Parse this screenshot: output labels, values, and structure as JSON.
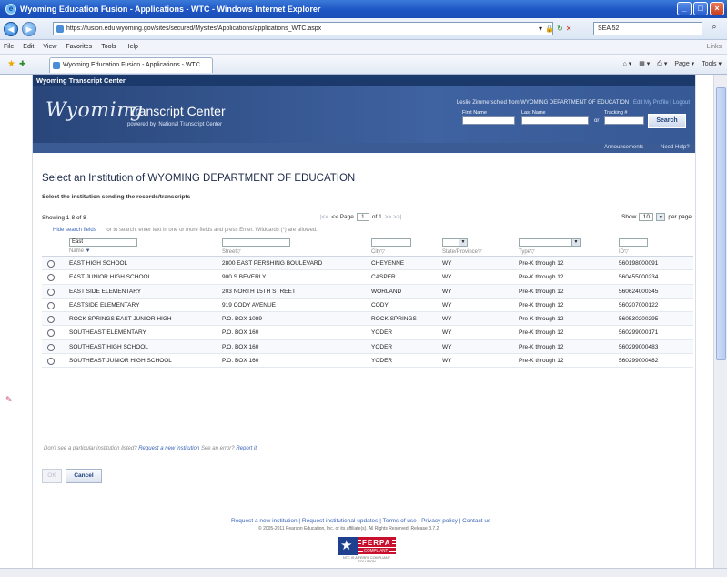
{
  "window": {
    "title": "Wyoming Education Fusion - Applications - WTC - Windows Internet Explorer",
    "url": "https://fusion.edu.wyoming.gov/sites/secured/Mysites/Applications/applications_WTC.aspx",
    "search_value": "SEA 52",
    "menu": [
      "File",
      "Edit",
      "View",
      "Favorites",
      "Tools",
      "Help"
    ],
    "links_label": "Links",
    "tab_label": "Wyoming Education Fusion - Applications - WTC",
    "tools": [
      "Page",
      "Tools"
    ]
  },
  "site": {
    "bar_title": "Wyoming Transcript Center",
    "logo_text": "Wyoming",
    "product": "Transcript Center",
    "powered_by": "powered by  National Transcript Center",
    "user_text": "Leslie Zimmerschied from WYOMING DEPARTMENT OF EDUCATION",
    "edit_profile": "Edit My Profile",
    "logout": "Logout",
    "first_name_label": "First Name",
    "last_name_label": "Last Name",
    "tracking_label": "Tracking #",
    "or_label": "or",
    "search_button": "Search",
    "announcements": "Announcements",
    "need_help": "Need Help?"
  },
  "main": {
    "heading": "Select an Institution of WYOMING DEPARTMENT OF EDUCATION",
    "subheading": "Select the institution sending the records/transcripts",
    "showing": "Showing 1-8 of 8",
    "pager_first": "|<<",
    "pager_prev": "<< Page",
    "page_value": "1",
    "pager_of": "of 1",
    "pager_next": ">> >>|",
    "show_label": "Show",
    "per_page_value": "10",
    "per_page_label": "per page",
    "hide_fields": "Hide search fields",
    "search_hint": "or to search, enter text in one or more fields and press Enter. Wildcards (*) are allowed.",
    "name_filter": "East",
    "columns": [
      "Name",
      "Street",
      "City",
      "State/Province",
      "Type",
      "ID"
    ],
    "rows": [
      {
        "name": "EAST HIGH SCHOOL",
        "street": "2800 EAST PERSHING BOULEVARD",
        "city": "CHEYENNE",
        "state": "WY",
        "type": "Pre-K through 12",
        "id": "560198000091"
      },
      {
        "name": "EAST JUNIOR HIGH SCHOOL",
        "street": "900 S BEVERLY",
        "city": "CASPER",
        "state": "WY",
        "type": "Pre-K through 12",
        "id": "560455000234"
      },
      {
        "name": "EAST SIDE ELEMENTARY",
        "street": "203 NORTH 15TH STREET",
        "city": "WORLAND",
        "state": "WY",
        "type": "Pre-K through 12",
        "id": "560624000345"
      },
      {
        "name": "EASTSIDE ELEMENTARY",
        "street": "919 CODY AVENUE",
        "city": "CODY",
        "state": "WY",
        "type": "Pre-K through 12",
        "id": "560207000122"
      },
      {
        "name": "ROCK SPRINGS EAST JUNIOR HIGH",
        "street": "P.O. BOX 1089",
        "city": "ROCK SPRINGS",
        "state": "WY",
        "type": "Pre-K through 12",
        "id": "560530200295"
      },
      {
        "name": "SOUTHEAST ELEMENTARY",
        "street": "P.O. BOX 160",
        "city": "YODER",
        "state": "WY",
        "type": "Pre-K through 12",
        "id": "560299000171"
      },
      {
        "name": "SOUTHEAST HIGH SCHOOL",
        "street": "P.O. BOX 160",
        "city": "YODER",
        "state": "WY",
        "type": "Pre-K through 12",
        "id": "560299000483"
      },
      {
        "name": "SOUTHEAST JUNIOR HIGH SCHOOL",
        "street": "P.O. BOX 160",
        "city": "YODER",
        "state": "WY",
        "type": "Pre-K through 12",
        "id": "560299000482"
      }
    ],
    "missing_prefix": "Don't see a particular institution listed?",
    "missing_link": "Request a new institution",
    "error_prefix": "See an error?",
    "error_link": "Report it",
    "ok_button": "OK",
    "cancel_button": "Cancel"
  },
  "footer": {
    "links": "Request a new institution | Request institutional updates | Terms of use | Privacy policy | Contact us",
    "copyright": "© 2005-2011 Pearson Education, Inc. or its affiliate(s). All Rights Reserved. Release 3.7.2",
    "ferpa": "FERPA",
    "ferpa_sub": "COMPLIANT",
    "ferpa_bottom": "NTC IS A FERPA COMPLIANT SOLUTION"
  }
}
